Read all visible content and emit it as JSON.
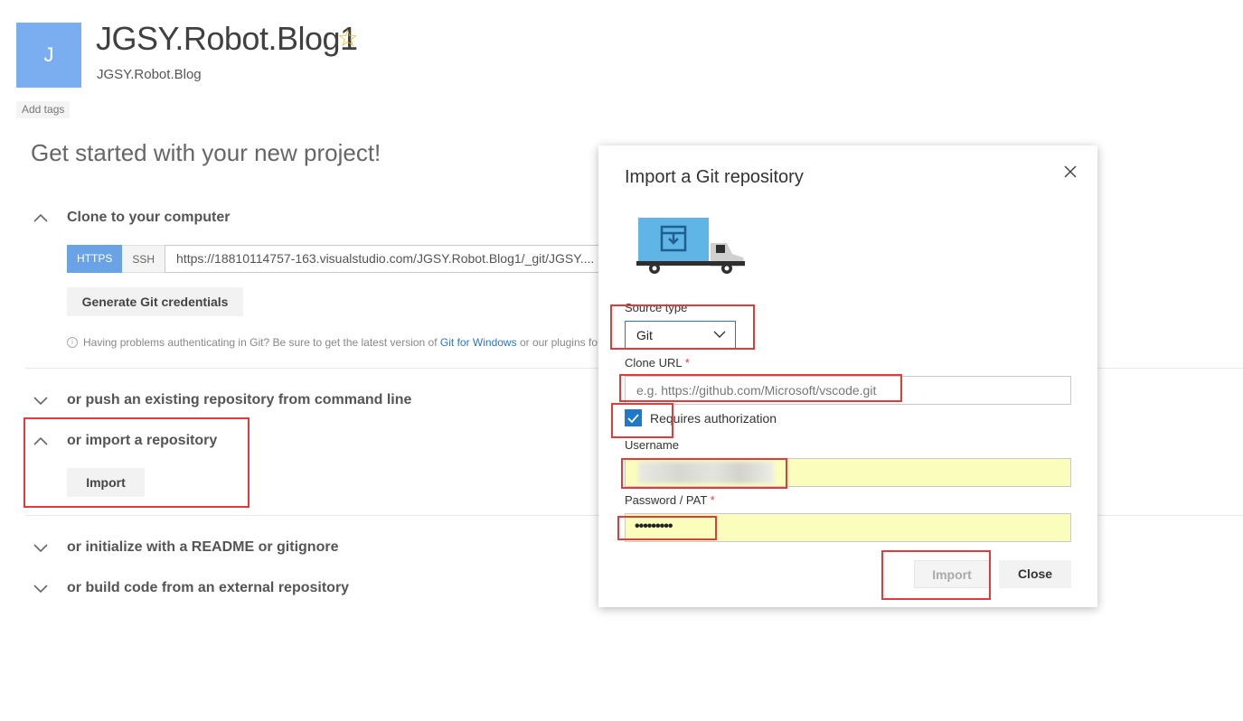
{
  "project": {
    "avatar_letter": "J",
    "title": "JGSY.Robot.Blog1",
    "star_icon": "star-outline-icon",
    "subtitle": "JGSY.Robot.Blog",
    "add_tags": "Add tags"
  },
  "main": {
    "heading": "Get started with your new project!",
    "clone": {
      "label": "Clone to your computer",
      "expanded": true,
      "https_label": "HTTPS",
      "ssh_label": "SSH",
      "url": "https://18810114757-163.visualstudio.com/JGSY.Robot.Blog1/_git/JGSY....",
      "generate_button": "Generate Git credentials",
      "hint_prefix": "Having problems authenticating in Git? Be sure to get the latest version of",
      "hint_link": "Git for Windows",
      "hint_suffix": "or our plugins fo"
    },
    "push": {
      "label": "or push an existing repository from command line",
      "expanded": false
    },
    "import": {
      "label": "or import a repository",
      "expanded": true,
      "button": "Import"
    },
    "readme": {
      "label": "or initialize with a README or gitignore",
      "expanded": false
    },
    "build": {
      "label": "or build code from an external repository",
      "expanded": false
    }
  },
  "dialog": {
    "title": "Import a Git repository",
    "source_type_label": "Source type",
    "source_type_value": "Git",
    "clone_url_label": "Clone URL",
    "required_mark": "*",
    "clone_url_placeholder": "e.g. https://github.com/Microsoft/vscode.git",
    "requires_auth_label": "Requires authorization",
    "requires_auth_checked": true,
    "username_label": "Username",
    "password_label": "Password / PAT",
    "password_masked": "•••••••••",
    "import_button": "Import",
    "close_button": "Close"
  },
  "colors": {
    "highlight_box": "#e23b3b",
    "accent": "#1e79c8",
    "autofill": "#fafdbc",
    "avatar": "#7aaef0"
  }
}
